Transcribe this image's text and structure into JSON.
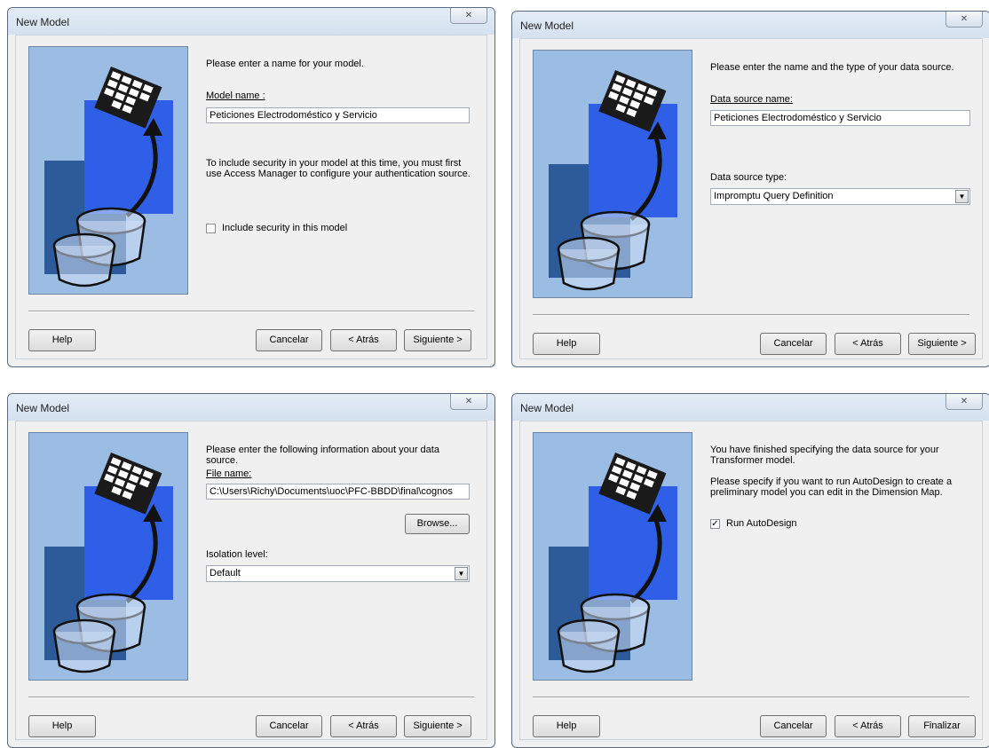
{
  "dialogs": [
    {
      "title": "New Model",
      "close_glyph": "✕",
      "message": "Please enter a name for your model.",
      "model_name_label": "Model name :",
      "model_name_value": "Peticiones Electrodoméstico y Servicio",
      "security_note": "To include security in your model at this time, you must first use Access Manager to configure your authentication source.",
      "security_checkbox_label": "Include security in this model",
      "security_checked": false,
      "buttons": {
        "help": "Help",
        "cancel": "Cancelar",
        "back": "< Atrás",
        "next": "Siguiente >"
      }
    },
    {
      "title": "New Model",
      "close_glyph": "✕",
      "message": "Please enter the name and the type of your data source.",
      "source_name_label": "Data source name:",
      "source_name_value": "Peticiones Electrodoméstico y Servicio",
      "source_type_label": "Data source type:",
      "source_type_value": "Impromptu Query Definition",
      "buttons": {
        "help": "Help",
        "cancel": "Cancelar",
        "back": "< Atrás",
        "next": "Siguiente >"
      }
    },
    {
      "title": "New Model",
      "close_glyph": "✕",
      "message": "Please enter the following information about your data source.",
      "file_name_label": "File name:",
      "file_name_value": "C:\\Users\\Richy\\Documents\\uoc\\PFC-BBDD\\final\\cognos",
      "browse_label": "Browse...",
      "isolation_label": "Isolation level:",
      "isolation_value": "Default",
      "buttons": {
        "help": "Help",
        "cancel": "Cancelar",
        "back": "< Atrás",
        "next": "Siguiente >"
      }
    },
    {
      "title": "New Model",
      "close_glyph": "✕",
      "message": "You have finished specifying the data source for your Transformer model.",
      "autodesign_note": "Please specify if you want to run AutoDesign to create a preliminary model you can edit in the Dimension Map.",
      "autodesign_checkbox_label": "Run AutoDesign",
      "autodesign_checked": true,
      "buttons": {
        "help": "Help",
        "cancel": "Cancelar",
        "back": "< Atrás",
        "finish": "Finalizar"
      }
    }
  ],
  "colors": {
    "picture_bg": "#9cbde3",
    "picture_blue": "#2f5fe6",
    "picture_dark": "#2d5a98"
  },
  "icons": [
    "close-icon",
    "wizard-illustration",
    "dropdown-arrow-icon",
    "checkbox-checked-icon"
  ]
}
